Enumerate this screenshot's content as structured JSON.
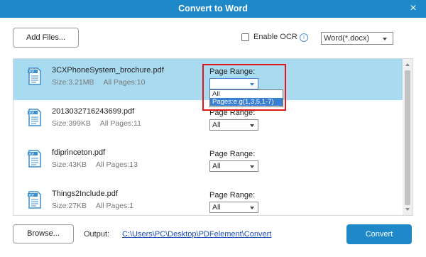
{
  "window": {
    "title": "Convert to Word",
    "close_glyph": "×"
  },
  "toolbar": {
    "add_files_label": "Add Files...",
    "enable_ocr_label": "Enable OCR",
    "ocr_checked": false,
    "info_icon": "info-icon",
    "format_value": "Word(*.docx)"
  },
  "files": [
    {
      "name": "3CXPhoneSystem_brochure.pdf",
      "size": "Size:3.21MB",
      "pages": "All Pages:10",
      "page_range_label": "Page Range:",
      "page_range_value": "",
      "selected": true
    },
    {
      "name": "2013032716243699.pdf",
      "size": "Size:399KB",
      "pages": "All Pages:11",
      "page_range_label": "Page Range:",
      "page_range_value": "All",
      "selected": false
    },
    {
      "name": "fdiprinceton.pdf",
      "size": "Size:43KB",
      "pages": "All Pages:13",
      "page_range_label": "Page Range:",
      "page_range_value": "All",
      "selected": false
    },
    {
      "name": "Things2Include.pdf",
      "size": "Size:27KB",
      "pages": "All Pages:1",
      "page_range_label": "Page Range:",
      "page_range_value": "All",
      "selected": false
    }
  ],
  "dropdown": {
    "options": [
      "All",
      "Pages:e.g(1,3,5,1-7)"
    ],
    "highlighted_index": 1
  },
  "footer": {
    "browse_label": "Browse...",
    "output_label": "Output:",
    "output_path": "C:\\Users\\PC\\Desktop\\PDFelement\\Convert",
    "convert_label": "Convert"
  },
  "colors": {
    "title_bar": "#1e88c9",
    "selected_row": "#a9dbf0",
    "convert_button": "#1e88c9",
    "highlight_box": "#e0151a",
    "option_highlight": "#3b7fd1"
  }
}
